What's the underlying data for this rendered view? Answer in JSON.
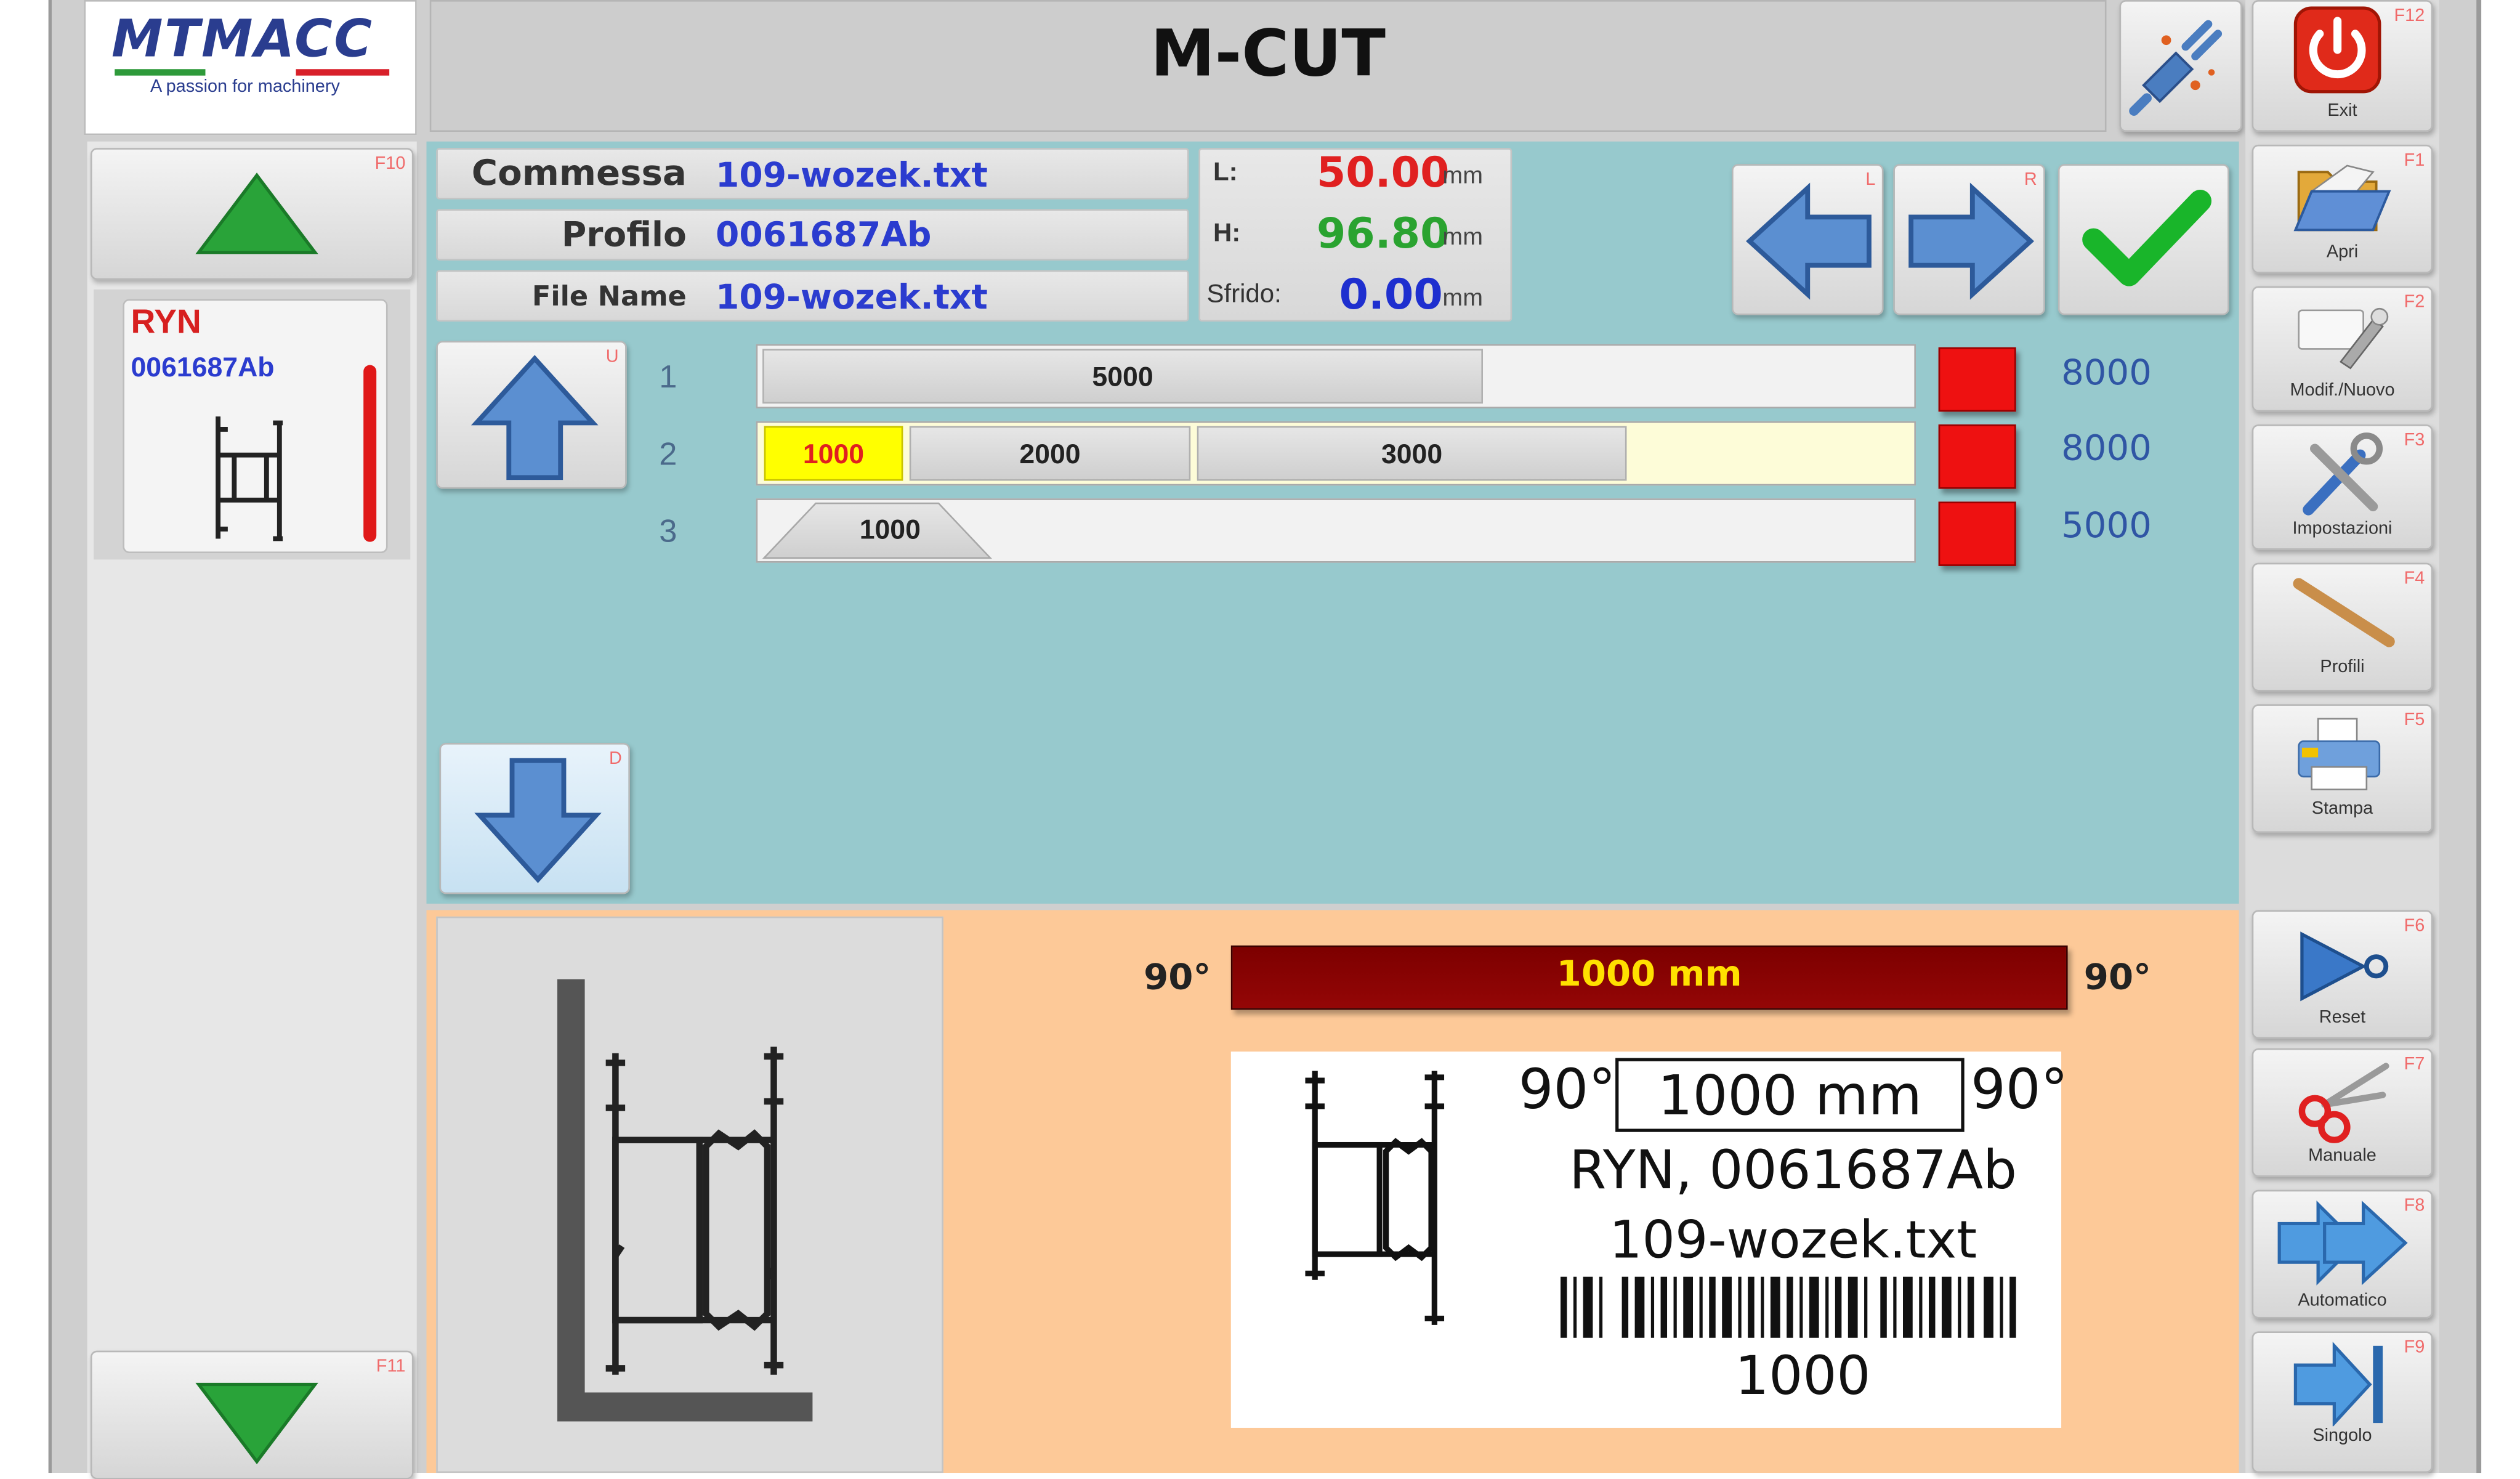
{
  "app": {
    "title": "M-CUT",
    "logo_text": "MTMACC",
    "logo_tagline": "A passion for machinery"
  },
  "left_panel": {
    "up_key": "F10",
    "down_key": "F11",
    "item": {
      "name": "RYN",
      "code": "0061687Ab"
    }
  },
  "info": {
    "commessa_label": "Commessa",
    "commessa_value": "109-wozek.txt",
    "profilo_label": "Profilo",
    "profilo_value": "0061687Ab",
    "filename_label": "File Name",
    "filename_value": "109-wozek.txt",
    "l_label": "L:",
    "l_value": "50.00",
    "h_label": "H:",
    "h_value": "96.80",
    "sfrido_label": "Sfrido:",
    "sfrido_value": "0.00",
    "unit": "mm"
  },
  "nav": {
    "left_key": "L",
    "right_key": "R",
    "up_key": "U",
    "down_key": "D"
  },
  "bars": [
    {
      "num": "1",
      "segments": [
        "5000"
      ],
      "total": "8000"
    },
    {
      "num": "2",
      "segments": [
        "1000",
        "2000",
        "3000"
      ],
      "total": "8000"
    },
    {
      "num": "3",
      "segments": [
        "1000"
      ],
      "total": "5000"
    }
  ],
  "cut": {
    "angle_left": "90°",
    "angle_right": "90°",
    "length": "1000 mm",
    "label": {
      "angle_left": "90°",
      "length": "1000 mm",
      "angle_right": "90°",
      "line1": "RYN, 0061687Ab",
      "line2": "109-wozek.txt",
      "barcode_value": "1000"
    }
  },
  "sidebar": {
    "exit": {
      "key": "F12",
      "label": "Exit"
    },
    "apri": {
      "key": "F1",
      "label": "Apri"
    },
    "modif": {
      "key": "F2",
      "label": "Modif./Nuovo"
    },
    "impostazioni": {
      "key": "F3",
      "label": "Impostazioni"
    },
    "profili": {
      "key": "F4",
      "label": "Profili"
    },
    "stampa": {
      "key": "F5",
      "label": "Stampa"
    },
    "reset": {
      "key": "F6",
      "label": "Reset"
    },
    "manuale": {
      "key": "F7",
      "label": "Manuale"
    },
    "automatico": {
      "key": "F8",
      "label": "Automatico"
    },
    "singolo": {
      "key": "F9",
      "label": "Singolo"
    }
  },
  "colors": {
    "accent_teal": "#97c9cd",
    "accent_peach": "#fdc998",
    "cut_bar": "#8b0000",
    "cut_text": "#ffe000",
    "active_segment": "#ffff00",
    "red": "#ee1111"
  }
}
